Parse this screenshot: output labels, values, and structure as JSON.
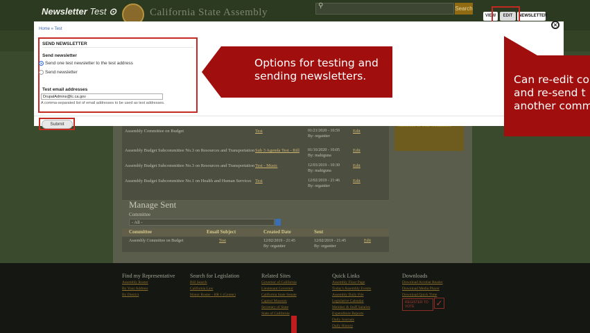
{
  "header": {
    "title_italic": "Newsletter",
    "title_rest": " Test",
    "site_name": "California State Assembly",
    "search_button": "Search",
    "tabs": [
      {
        "label": "VIEW"
      },
      {
        "label": "EDIT"
      },
      {
        "label": "NEWSLETTER"
      }
    ]
  },
  "modal": {
    "breadcrumb": "Home » Test",
    "fieldset_title": "SEND NEWSLETTER",
    "send_label": "Send newsletter",
    "options": [
      {
        "label": "Send one test newsletter to the test address",
        "selected": true
      },
      {
        "label": "Send newsletter",
        "selected": false
      }
    ],
    "email_label": "Test email addresses",
    "email_value": "DrupalAdmins@lc.ca.gov",
    "email_help": "A comma-separated list of email addresses to be used as test addresses.",
    "submit_label": "Submit"
  },
  "callouts": {
    "testing": "Options for testing and sending newsletters.",
    "reedit_lines": [
      "Can re-edit co",
      "and re-send t",
      "another comm"
    ]
  },
  "background": {
    "rows": [
      {
        "committee": "Assembly Committee on Budget",
        "subject": "Test",
        "date": "01/21/2020 - 10:59",
        "by": "By: organiter",
        "action": "Edit"
      },
      {
        "committee": "Assembly Budget Subcommittee No.3 on Resources and Transportation",
        "subject": "Sub 3 Agenda Test - Bill",
        "date": "01/16/2020 - 10:05",
        "by": "By: mahiguna",
        "action": "Edit"
      },
      {
        "committee": "Assembly Budget Subcommittee No.3 on Resources and Transportation",
        "subject": "Test - Music",
        "date": "12/03/2019 - 10:30",
        "by": "By: mahiguna",
        "action": "Edit"
      },
      {
        "committee": "Assembly Budget Subcommittee No.1 on Health and Human Services",
        "subject": "Test",
        "date": "12/02/2019 - 21:46",
        "by": "By: organiter",
        "action": "Edit"
      }
    ],
    "subscribe_text": "Subscribe to Your Committee",
    "manage_title": "Manage Sent",
    "committee_label": "Committee",
    "committee_value": "- All -",
    "sent_headers": [
      "Committee",
      "Email Subject",
      "Created Date",
      "Sent"
    ],
    "sent_row": {
      "committee": "Assembly Committee on Budget",
      "subject": "Test",
      "created": "12/02/2019 - 21:45",
      "created_by": "By: organiter",
      "sent": "12/02/2019 - 21:45",
      "sent_by": "By: organiter",
      "action": "Edit"
    }
  },
  "footer": {
    "columns": [
      {
        "title": "Find my Representative",
        "links": [
          "Assembly Roster",
          "By Your Address",
          "By District"
        ]
      },
      {
        "title": "Search for Legislation",
        "links": [
          "Bill Search",
          "California Law",
          "Honor Roster - HR 1 (Center)"
        ]
      },
      {
        "title": "Related Sites",
        "links": [
          "Governor of California",
          "Lieutenant Governor",
          "California State Senate",
          "Capitol Museum",
          "Secretary of State",
          "State of California"
        ]
      },
      {
        "title": "Quick Links",
        "links": [
          "Assembly Floor Page",
          "Today's Assembly Events",
          "Assembly Daily File",
          "Legislative Calendar",
          "Member & Staff Salaries",
          "Expenditure Reports",
          "Daily Journals",
          "Daily History"
        ]
      },
      {
        "title": "Downloads",
        "links": [
          "Download Acrobat Reader",
          "Download Media Player",
          "Download Quick Time"
        ]
      }
    ],
    "register_text": "REGISTER TO VOTE",
    "register_check": "✓"
  }
}
